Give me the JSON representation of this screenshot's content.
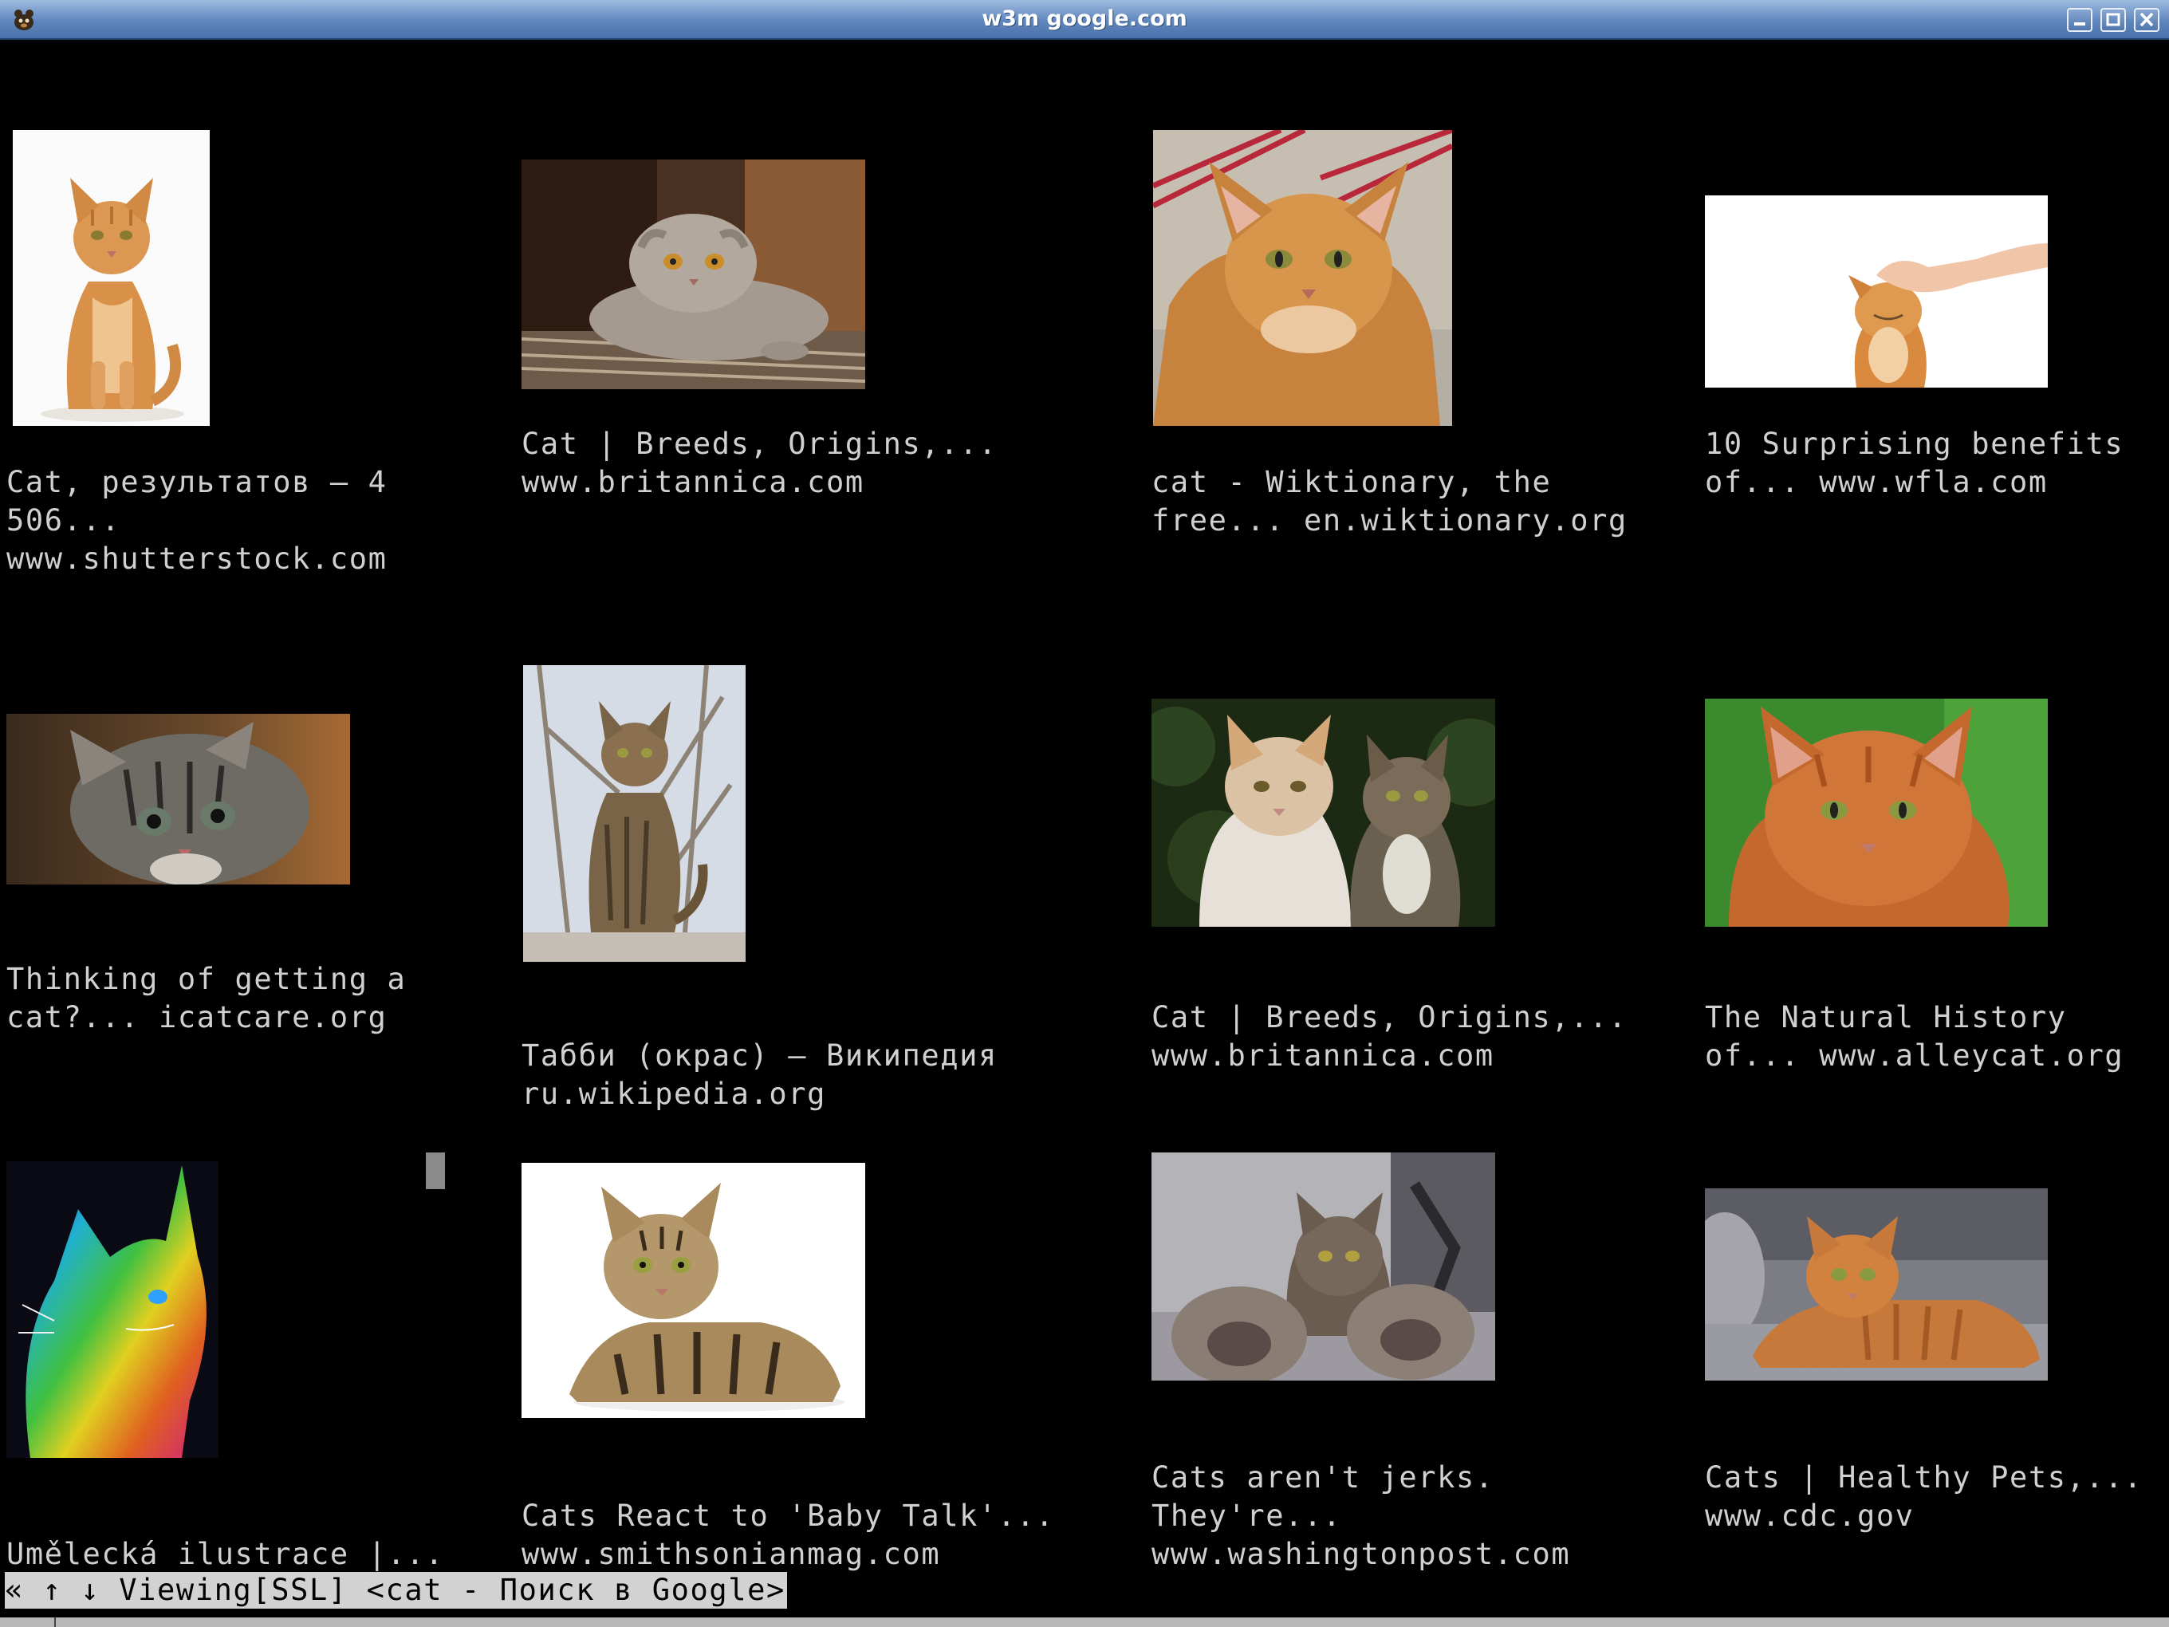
{
  "window": {
    "title": "w3m google.com",
    "app_icon": "w3m-app-icon",
    "controls": [
      "minimize-icon",
      "maximize-icon",
      "close-icon"
    ]
  },
  "results": [
    {
      "caption": "Cat, результатов — 4\n506...\nwww.shutterstock.com",
      "image": "orange tabby cat sitting on white background"
    },
    {
      "caption": "Cat | Breeds, Origins,...\nwww.britannica.com",
      "image": "grey scottish fold cat lying on a mat"
    },
    {
      "caption": "cat - Wiktionary, the\nfree... en.wiktionary.org",
      "image": "orange cat close-up portrait"
    },
    {
      "caption": "10 Surprising benefits\nof... www.wfla.com",
      "image": "hand petting an orange cat on white background"
    },
    {
      "caption": "Thinking of getting a\ncat?... icatcare.org",
      "image": "tabby kitten peeking"
    },
    {
      "caption": "Табби (окрас) — Википедия\nru.wikipedia.org",
      "image": "tabby cat sitting outdoors"
    },
    {
      "caption": "Cat | Breeds, Origins,...\nwww.britannica.com",
      "image": "two cats, a white long-haired and a tabby"
    },
    {
      "caption": "The Natural History\nof... www.alleycat.org",
      "image": "orange cat on green background"
    },
    {
      "caption": "Umělecká ilustrace |...\nwww.posters.cz",
      "image": "rainbow colored cat illustration"
    },
    {
      "caption": "Cats React to 'Baby Talk'...\nwww.smithsonianmag.com",
      "image": "bengal tabby cat lying on white background"
    },
    {
      "caption": "Cats aren't jerks.\nThey're...\nwww.washingtonpost.com",
      "image": "cat with paws reaching toward camera"
    },
    {
      "caption": "Cats | Healthy Pets,...\nwww.cdc.gov",
      "image": "orange cat lying on a grey sofa"
    }
  ],
  "status_bar": "« ↑ ↓ Viewing[SSL] <cat - Поиск в Google>"
}
